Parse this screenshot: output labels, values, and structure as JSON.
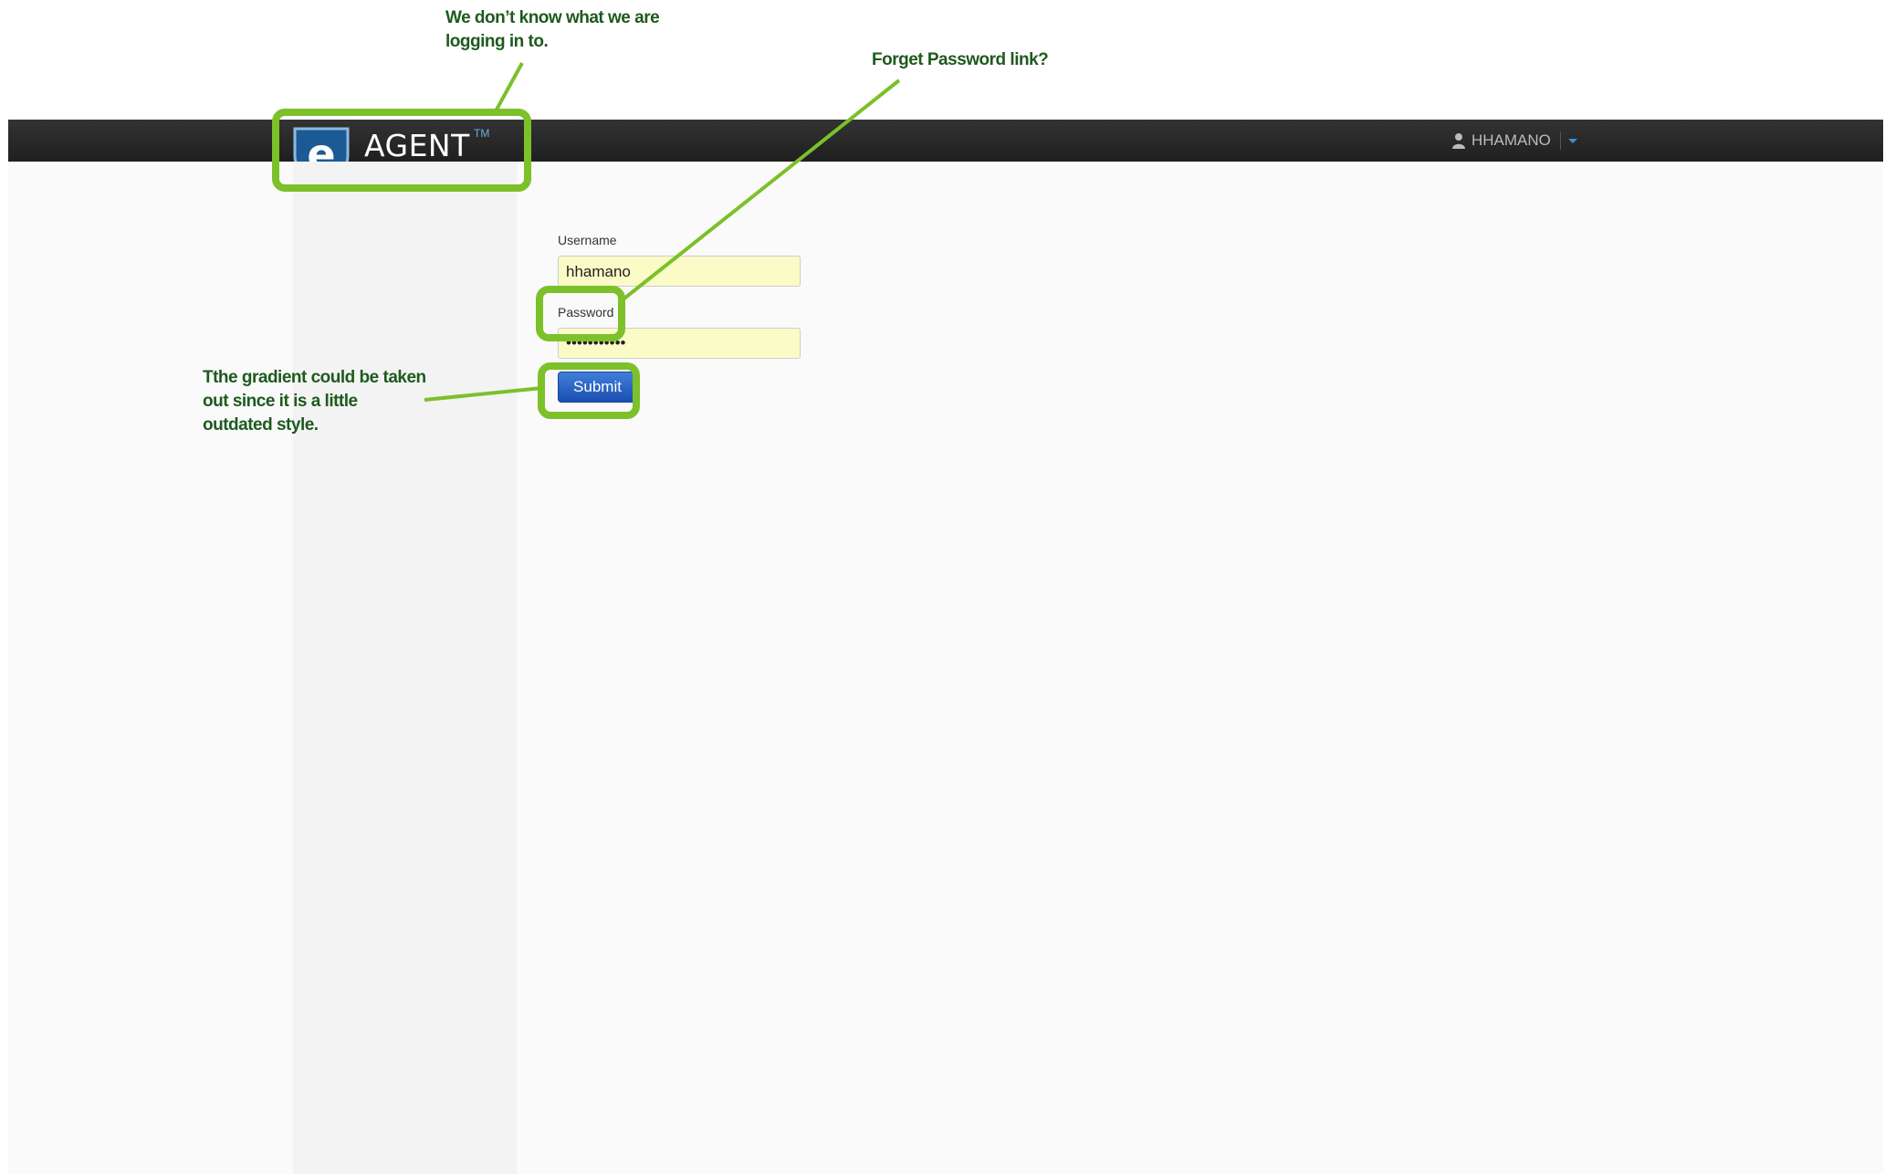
{
  "app": {
    "brand": "AGENT",
    "trademark": "TM",
    "logo_letter": "e",
    "user_name": "HHAMANO",
    "colors": {
      "navbar": "#2a2a2a",
      "accent": "#3a8fd0",
      "field_fill": "#fbfbc7",
      "button": "#2a63c4"
    }
  },
  "form": {
    "username_label": "Username",
    "username_value": "hhamano",
    "password_label": "Password",
    "password_value": "•••••••••••",
    "submit_label": "Submit"
  },
  "annotations": {
    "logo_note": "We don’t know what we are logging in to.",
    "password_note": "Forget Password link?",
    "submit_note": "Tthe gradient could be taken out since it is a little outdated style.",
    "highlight_color": "#7cc02a",
    "text_color": "#1e5a1e"
  }
}
